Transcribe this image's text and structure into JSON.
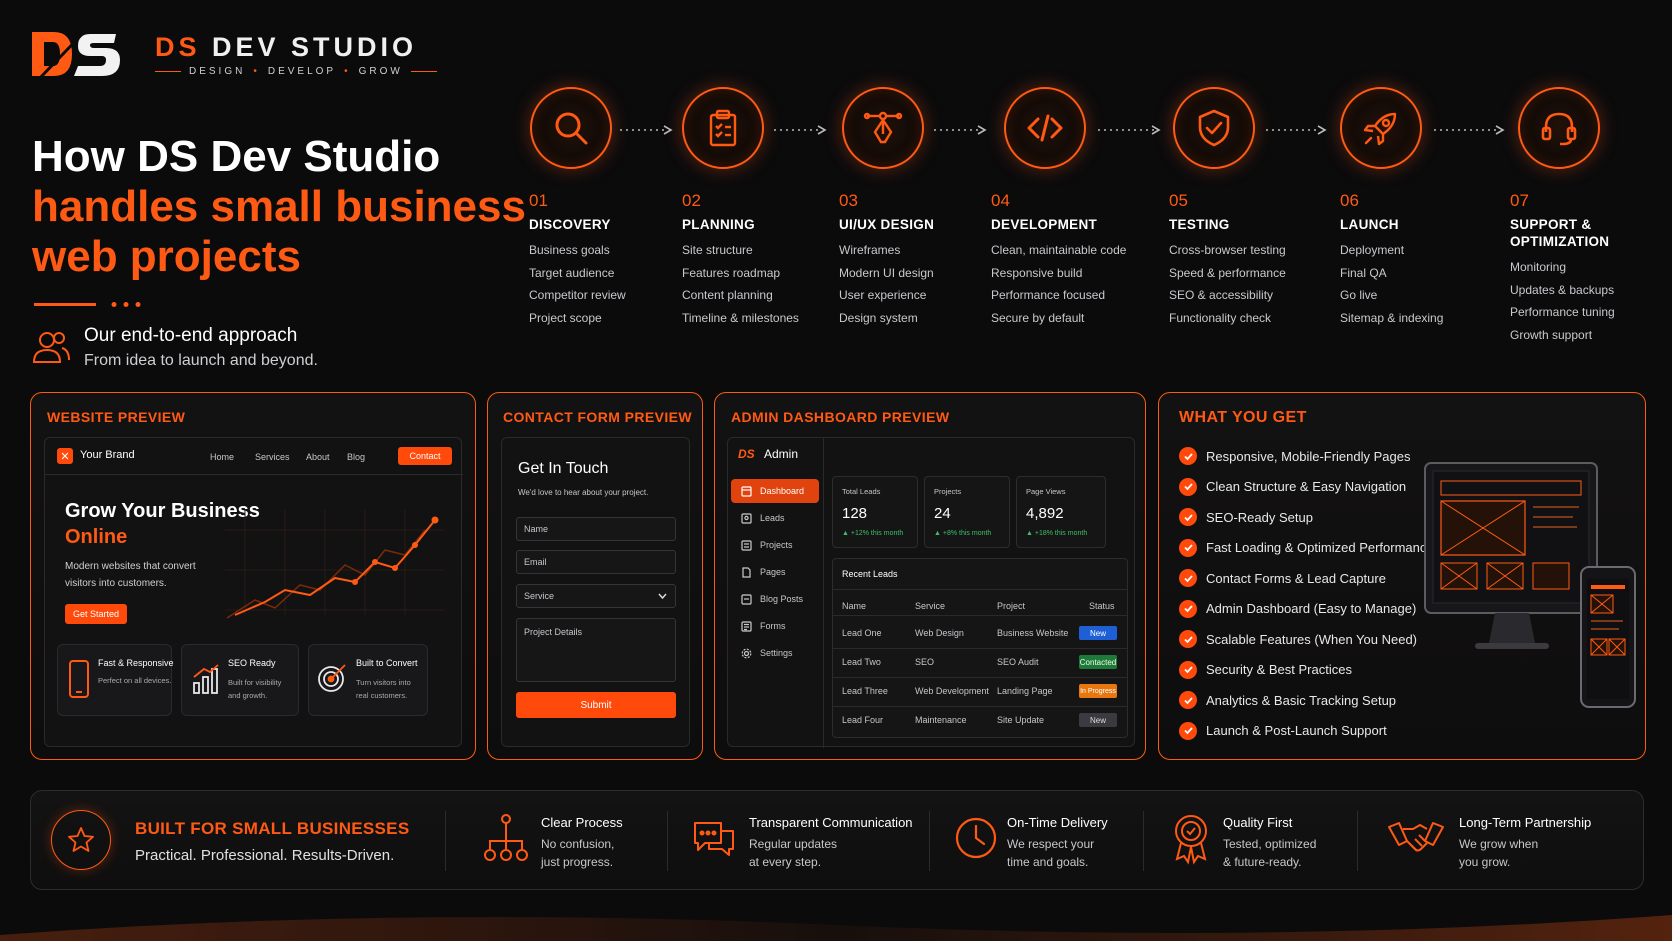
{
  "brand": {
    "ds": "DS",
    "name_rest": "DEV STUDIO",
    "tagline_1": "DESIGN",
    "tagline_2": "DEVELOP",
    "tagline_3": "GROW",
    "tagline_sep": "•"
  },
  "hero": {
    "title_line1": "How DS Dev Studio",
    "title_line2": "handles small business",
    "title_line3": "web projects",
    "approach_title": "Our end-to-end approach",
    "approach_sub": "From idea to launch and beyond."
  },
  "steps": [
    {
      "num": "01",
      "title": "DISCOVERY",
      "icon": "search-icon",
      "items": [
        "Business goals",
        "Target audience",
        "Competitor review",
        "Project scope"
      ]
    },
    {
      "num": "02",
      "title": "PLANNING",
      "icon": "clipboard-icon",
      "items": [
        "Site structure",
        "Features roadmap",
        "Content planning",
        "Timeline & milestones"
      ]
    },
    {
      "num": "03",
      "title": "UI/UX DESIGN",
      "icon": "pen-tool-icon",
      "items": [
        "Wireframes",
        "Modern UI design",
        "User experience",
        "Design system"
      ]
    },
    {
      "num": "04",
      "title": "DEVELOPMENT",
      "icon": "code-icon",
      "items": [
        "Clean, maintainable code",
        "Responsive build",
        "Performance focused",
        "Secure by default"
      ]
    },
    {
      "num": "05",
      "title": "TESTING",
      "icon": "shield-check-icon",
      "items": [
        "Cross-browser testing",
        "Speed & performance",
        "SEO & accessibility",
        "Functionality check"
      ]
    },
    {
      "num": "06",
      "title": "LAUNCH",
      "icon": "rocket-icon",
      "items": [
        "Deployment",
        "Final QA",
        "Go live",
        "Sitemap & indexing"
      ]
    },
    {
      "num": "07",
      "title_l1": "SUPPORT &",
      "title_l2": "OPTIMIZATION",
      "icon": "headset-icon",
      "items": [
        "Monitoring",
        "Updates & backups",
        "Performance tuning",
        "Growth support"
      ]
    }
  ],
  "website_preview": {
    "heading": "WEBSITE PREVIEW",
    "brand": "Your Brand",
    "nav": [
      "Home",
      "Services",
      "About",
      "Blog"
    ],
    "contact": "Contact",
    "hero_l1": "Grow Your Business",
    "hero_l2": "Online",
    "desc_l1": "Modern websites that convert",
    "desc_l2": "visitors into customers.",
    "cta": "Get Started",
    "features": [
      {
        "title": "Fast & Responsive",
        "l1": "Perfect on all devices.",
        "l2": ""
      },
      {
        "title": "SEO Ready",
        "l1": "Built for visibility",
        "l2": "and growth."
      },
      {
        "title": "Built to Convert",
        "l1": "Turn visitors into",
        "l2": "real customers."
      }
    ]
  },
  "contact_form": {
    "heading": "CONTACT FORM PREVIEW",
    "title": "Get In Touch",
    "sub": "We'd love to hear about your project.",
    "name": "Name",
    "email": "Email",
    "service": "Service",
    "details": "Project Details",
    "submit": "Submit"
  },
  "admin": {
    "heading": "ADMIN DASHBOARD PREVIEW",
    "logo_ds": "DS",
    "logo_text": "Admin",
    "nav": [
      "Dashboard",
      "Leads",
      "Projects",
      "Pages",
      "Blog Posts",
      "Forms",
      "Settings"
    ],
    "stats": [
      {
        "label": "Total Leads",
        "value": "128",
        "delta": "+12% this month"
      },
      {
        "label": "Projects",
        "value": "24",
        "delta": "+8% this month"
      },
      {
        "label": "Page Views",
        "value": "4,892",
        "delta": "+18% this month"
      }
    ],
    "recent_title": "Recent Leads",
    "columns": [
      "Name",
      "Service",
      "Project",
      "Status"
    ],
    "rows": [
      {
        "name": "Lead One",
        "service": "Web Design",
        "project": "Business Website",
        "status": "New",
        "color": "#1f5fd6"
      },
      {
        "name": "Lead Two",
        "service": "SEO",
        "project": "SEO Audit",
        "status": "Contacted",
        "color": "#1f7a3a"
      },
      {
        "name": "Lead Three",
        "service": "Web Development",
        "project": "Landing Page",
        "status": "In Progress",
        "color": "#e8770f"
      },
      {
        "name": "Lead Four",
        "service": "Maintenance",
        "project": "Site Update",
        "status": "New",
        "color": "#3a3a40"
      }
    ]
  },
  "what_you_get": {
    "heading": "WHAT YOU GET",
    "items": [
      "Responsive, Mobile-Friendly Pages",
      "Clean Structure & Easy Navigation",
      "SEO-Ready Setup",
      "Fast Loading & Optimized Performance",
      "Contact Forms & Lead Capture",
      "Admin Dashboard (Easy to Manage)",
      "Scalable Features (When You Need)",
      "Security & Best Practices",
      "Analytics & Basic Tracking Setup",
      "Launch & Post-Launch Support"
    ]
  },
  "footer": {
    "title": "BUILT FOR SMALL BUSINESSES",
    "sub": "Practical. Professional. Results-Driven.",
    "features": [
      {
        "title": "Clear Process",
        "l1": "No confusion,",
        "l2": "just progress.",
        "icon": "flow-icon"
      },
      {
        "title": "Transparent Communication",
        "l1": "Regular updates",
        "l2": "at every step.",
        "icon": "chat-icon"
      },
      {
        "title": "On-Time Delivery",
        "l1": "We respect your",
        "l2": "time and goals.",
        "icon": "clock-icon"
      },
      {
        "title": "Quality First",
        "l1": "Tested, optimized",
        "l2": "& future-ready.",
        "icon": "award-icon"
      },
      {
        "title": "Long-Term Partnership",
        "l1": "We grow when",
        "l2": "you grow.",
        "icon": "handshake-icon"
      }
    ]
  },
  "colors": {
    "accent": "#ff5a14",
    "background": "#0b0b0c",
    "panel_border": "#ff5a14"
  }
}
